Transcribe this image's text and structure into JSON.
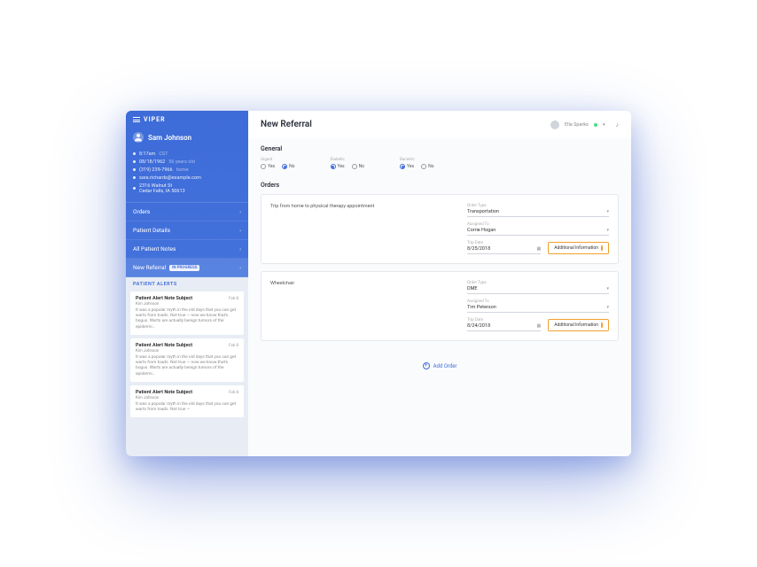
{
  "brand": "VIPER",
  "user": {
    "name": "Ella Sparks"
  },
  "patient": {
    "name": "Sam Johnson",
    "time": "8:17am",
    "tz": "CST",
    "dob": "08/18/1962",
    "age": "56 years old",
    "phone": "(319) 239-7966",
    "phone_type": "home",
    "email": "sara.richards@example.com",
    "addr1": "2316 Walnut St",
    "addr2": "Cedar Falls, IA 50613"
  },
  "nav": {
    "orders": "Orders",
    "details": "Patient Details",
    "notes": "All Patient Notes",
    "referral": "New Referral",
    "badge": "IN PROGRESS"
  },
  "alerts": {
    "header": "PATIENT ALERTS",
    "items": [
      {
        "subj": "Patient Alert Note Subject",
        "date": "Feb 8",
        "author": "Kim Johnson",
        "body": "It was a popular myth in the old days that you can get warts from toads. Not true — now we know that's bogus. Warts are actually benign tumors of the epidermi..."
      },
      {
        "subj": "Patient Alert Note Subject",
        "date": "Feb 8",
        "author": "Kim Johnson",
        "body": "It was a popular myth in the old days that you can get warts from toads. Not true — now we know that's bogus. Warts are actually benign tumors of the epidermi..."
      },
      {
        "subj": "Patient Alert Note Subject",
        "date": "Feb 8",
        "author": "Kim Johnson",
        "body": "It was a popular myth in the old days that you can get warts from toads. Not true —"
      }
    ]
  },
  "page": {
    "title": "New Referral"
  },
  "general": {
    "title": "General",
    "groups": [
      {
        "label": "Urgent",
        "opts": [
          "Yes",
          "No"
        ],
        "selected": "No"
      },
      {
        "label": "Diabetic",
        "opts": [
          "Yes",
          "No"
        ],
        "selected": "Yes"
      },
      {
        "label": "Bariatric",
        "opts": [
          "Yes",
          "No"
        ],
        "selected": "Yes"
      }
    ]
  },
  "orders": {
    "title": "Orders",
    "addl_btn": "Additional Information",
    "add_btn": "Add Order",
    "items": [
      {
        "desc": "Trip from home to physical therapy appointment",
        "type_lbl": "Order Type",
        "type": "Transportation",
        "assign_lbl": "Assigned To",
        "assign": "Corrie Hogan",
        "date_lbl": "Trip Date",
        "date": "8/25/2018"
      },
      {
        "desc": "Wheelchair",
        "type_lbl": "Order Type",
        "type": "DME",
        "assign_lbl": "Assigned To",
        "assign": "Tim Peterson",
        "date_lbl": "Trip Date",
        "date": "8/24/2018"
      }
    ]
  }
}
